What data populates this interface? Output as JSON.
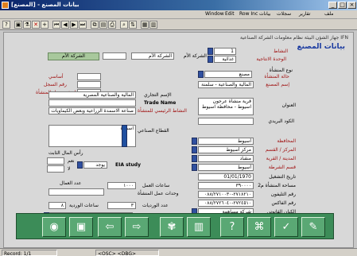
{
  "window": {
    "title": "بيانات المصنع - [المصنع]"
  },
  "menus": [
    {
      "label": "Window"
    },
    {
      "label": "Edit"
    },
    {
      "label": "Row Inc"
    },
    {
      "label": "بيانات"
    },
    {
      "label": "سجلات"
    },
    {
      "label": "تقارير"
    },
    {
      "label": "ملف"
    }
  ],
  "toolbar_icons": [
    "help-icon",
    "save-icon",
    "filter-icon",
    "delete-icon",
    "add-icon",
    "first-record-icon",
    "prev-record-icon",
    "next-record-icon",
    "last-record-icon",
    "copy-icon",
    "paste-icon",
    "print-icon",
    "find-icon",
    "sort-icon",
    "query-icon",
    "exit-icon"
  ],
  "form": {
    "header_subtitle": "IFN جهاز الشؤن البيئة نظام معلومات الشركة الصناعية",
    "heading": "بيانات المصنع",
    "labels": {
      "company": "الشركة الأم",
      "activity": "النشاط",
      "foundation_type": "الوحدة الانتاجية",
      "company_type": "نوع المنشأة",
      "factory_name": "إسم المصنع",
      "commercial_name": "الإسم التجاري",
      "trade_name": "Trade Name",
      "activity_detail": "النشاط الرئيسي للمنشأة",
      "address": "العنوان",
      "postal_code": "الكود البريدي",
      "governorate": "المحافظة",
      "center": "المركز / القسم",
      "city": "المدينة / القرية",
      "sector": "قسم الشرطة",
      "operation_date": "تاريخ التشغيل",
      "area": "مساحة المنشأة م2",
      "phone": "رقم التليفون",
      "fax": "رقم الفاكس",
      "legal_entity": "الكيان القانوني",
      "region_type": "طبيعة المنطقة",
      "industrial_sector": "القطاع الصناعي",
      "workers_count": "عدد العمال",
      "shifts": "عدد الورديات",
      "working_hours": "ساعات العمل",
      "shift_hours": "ساعات الوردية",
      "admin_type": "الادارة الاشرافية",
      "eia_study": "EIA study",
      "reg_number": "رقم السجل",
      "production_units": "وحدات عمل المنشأة",
      "fixed_capital": "رأس المال الثابت",
      "registration_date": "تاريخ تسجيل المنشأة",
      "status": "حالة المنشأة"
    },
    "values": {
      "company": "الشركة الأم",
      "unit": "1",
      "activity_code": "أساسي",
      "foundation": "غذائية",
      "company_type": "مصنع",
      "factory_name": "المالية والصناعية - سلمنة",
      "commercial_name": "المالية والصناعية المصرية",
      "activity_detail": "صناعة الاسمدة الزراعية وبعض الكيماويات",
      "address": "قرية منشاة عرجون اسيوط - محافظة اسيوط",
      "postal_code": "",
      "industrial_sector": "اسمدة",
      "governorate": "أسيوط",
      "center": "مركز أسيوط",
      "city": "منقباد",
      "sector": "أسيوط",
      "operation_date": "01/01/1970",
      "area": "٣٩٠٠٠٠",
      "phone": "٢٧١٨٢١٠-٠٨٨/٢٧١٠٠٣٠",
      "fax": "٢٧٢٤٥١٠-٠٨٨/٢٧٢٦٠٤٠",
      "legal_entity": "شركة مساهمة",
      "region_type": "سكني زراعي",
      "eia_select": "يوجد",
      "workers_count": "١٠٠٠",
      "shifts": "٣",
      "shift_hours": "٨",
      "admin_type": "المعدة",
      "yes_label": "نعم",
      "no_label": "لا"
    },
    "side_box": {
      "title": "الشركة الأم"
    }
  },
  "nav_buttons": [
    "exit-icon",
    "print-icon",
    "prev-icon",
    "next-icon",
    "tree-icon",
    "list-icon",
    "help-icon",
    "cut-icon",
    "check-icon",
    "edit-icon"
  ],
  "status": {
    "record": "Record: 1/1",
    "mode": "<OSC> <DBG>"
  }
}
